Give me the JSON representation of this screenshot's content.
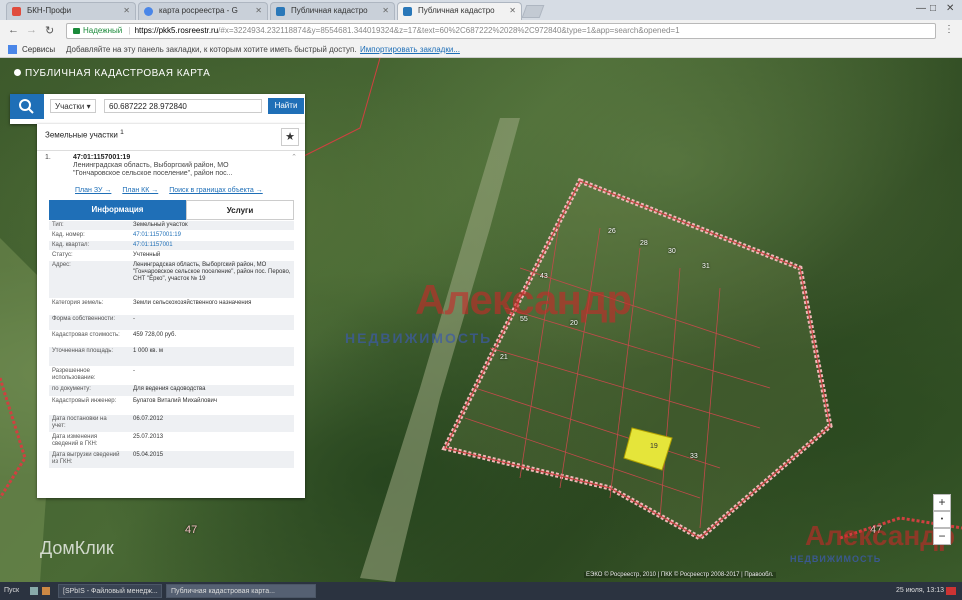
{
  "browser": {
    "tabs": [
      {
        "title": "БКН-Профи"
      },
      {
        "title": "карта росреестра - G"
      },
      {
        "title": "Публичная кадастро"
      },
      {
        "title": "Публичная кадастро"
      }
    ],
    "secure_label": "Надежный",
    "url_host": "https://pkk5.rosreestr.ru",
    "url_rest": "/#x=3224934.232118874&y=8554681.344019324&z=17&text=60%2C687222%2028%2C972840&type=1&app=search&opened=1",
    "bookmarks_services": "Сервисы",
    "bookmarks_hint": "Добавляйте на эту панель закладки, к которым хотите иметь быстрый доступ.",
    "bookmarks_import": "Импортировать закладки..."
  },
  "map": {
    "title": "ПУБЛИЧНАЯ КАДАСТРОВАЯ КАРТА",
    "search_type": "Участки",
    "coords": "60.687222 28.972840",
    "find_label": "Найти",
    "parcel_label_47": "47",
    "copyright": "ЕЭКО © Росреестр, 2010 | ПКК © Росреестр 2008-2017 | Правообл.",
    "watermark_brand": "Александр",
    "watermark_sub": "НЕДВИЖИМОСТЬ",
    "domclick": "ДомКлик",
    "zoom_in": "+",
    "zoom_out": "−",
    "parcels": [
      "26",
      "19",
      "28",
      "30",
      "31",
      "43",
      "55",
      "20",
      "21",
      "33"
    ]
  },
  "results": {
    "header": "Земельные участки",
    "header_count": "1",
    "item_index": "1.",
    "cadastral_number": "47:01:1157001:19",
    "address_short": "Ленинградская область, Выборгский район, МО \"Гончаровское сельское поселение\", район пос...",
    "links": [
      "План ЗУ →",
      "План КК →",
      "Поиск в границах объекта →"
    ],
    "tab_info": "Информация",
    "tab_services": "Услуги",
    "attributes": [
      {
        "k": "Тип:",
        "v": "Земельный участок"
      },
      {
        "k": "Кад. номер:",
        "v": "47:01:1157001:19",
        "link": true
      },
      {
        "k": "Кад. квартал:",
        "v": "47:01:1157001",
        "link": true
      },
      {
        "k": "Статус:",
        "v": "Учтенный"
      },
      {
        "k": "Адрес:",
        "v": "Ленинградская область, Выборгский район, МО \"Гончаровское сельское поселение\", район пос. Перово, СНТ \"Ёрко\", участок № 19"
      },
      {
        "k": "Категория земель:",
        "v": "Земли сельскохозяйственного назначения"
      },
      {
        "k": "Форма собственности:",
        "v": "-"
      },
      {
        "k": "Кадастровая стоимость:",
        "v": "459 728,00 руб."
      },
      {
        "k": "Уточненная площадь:",
        "v": "1 000 кв. м"
      },
      {
        "k": "Разрешенное использование:",
        "v": "-"
      },
      {
        "k": "по документу:",
        "v": "Для ведения садоводства"
      },
      {
        "k": "Кадастровый инженер:",
        "v": "Булатов Виталий Михайлович"
      },
      {
        "k": "Дата постановки на учет:",
        "v": "06.07.2012"
      },
      {
        "k": "Дата изменения сведений в ГКН:",
        "v": "25.07.2013"
      },
      {
        "k": "Дата выгрузки сведений из ГКН:",
        "v": "05.04.2015"
      }
    ]
  },
  "taskbar": {
    "start": "Пуск",
    "tasks": [
      "[SPbIS - Файловый менедж...",
      "Публичная кадастровая карта..."
    ],
    "clock": "25 июля, 13:13"
  }
}
